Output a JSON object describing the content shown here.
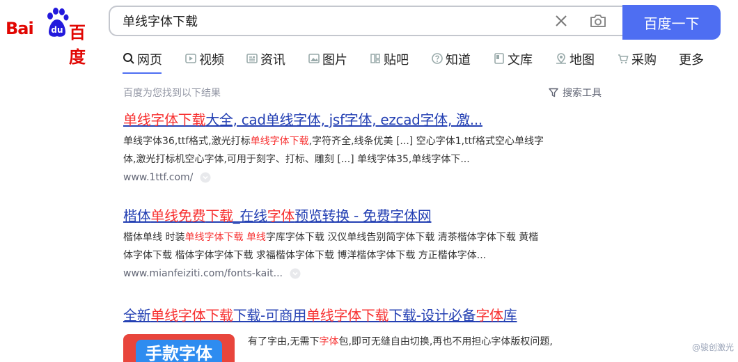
{
  "logo": {
    "text_left": "Bai",
    "text_paw": "du",
    "text_right": "百度"
  },
  "search": {
    "query": "单线字体下载",
    "button_label": "百度一下"
  },
  "tabs": [
    {
      "label": "网页",
      "icon": "search-icon"
    },
    {
      "label": "视频",
      "icon": "video-icon"
    },
    {
      "label": "资讯",
      "icon": "news-icon"
    },
    {
      "label": "图片",
      "icon": "image-icon"
    },
    {
      "label": "贴吧",
      "icon": "tieba-icon"
    },
    {
      "label": "知道",
      "icon": "question-icon"
    },
    {
      "label": "文库",
      "icon": "doc-icon"
    },
    {
      "label": "地图",
      "icon": "map-icon"
    },
    {
      "label": "采购",
      "icon": "cart-icon"
    },
    {
      "label": "更多",
      "icon": ""
    }
  ],
  "meta": {
    "result_count": "百度为您找到以下结果",
    "tools_label": "搜索工具"
  },
  "results": [
    {
      "title_parts": [
        "单线字体下载",
        "大全, cad单线字体, jsf字体, ezcad字体, 激..."
      ],
      "abstract_line1_parts": [
        "单线字体36,ttf格式,激光打标",
        "单线字体下载",
        ",字符齐全,线条优美 [...] 空心字体1,ttf格式空心单线字"
      ],
      "abstract_line2": "体,激光打标机空心字体,可用于刻字、打标、雕刻 [...] 单线字体35,单线字体下...",
      "url": "www.1ttf.com/"
    },
    {
      "title_parts": [
        "楷体",
        "单线",
        "免费",
        "下载",
        "_在线",
        "字体",
        "预览转换 - 免费字体网"
      ],
      "abstract_line1_parts": [
        "楷体单线 时装",
        "单线字体下载",
        " ",
        "单线",
        "字库字体下载 汉仪单线告别简字体下载 清茶楷体字体下载 黄楷"
      ],
      "abstract_line2": "体字体下载 楷体字体字体下载 求福楷体字体下载 博洋楷体字体下载 方正楷体字体...",
      "url": "www.mianfeiziti.com/fonts-kait..."
    },
    {
      "title_parts": [
        "全新",
        "单线字体下载",
        "下载-可商用",
        "单线字体下载",
        "下载-设计必备",
        "字体",
        "库"
      ],
      "abstract_line1_parts": [
        "有了字由,无需下",
        "字体",
        "包,即可无缝自由切换,再也不用担心字体版权问题,"
      ],
      "thumb_text": "手款字体"
    }
  ],
  "watermark": "@骏创激光",
  "colors": {
    "brand_blue": "#4e6ef2",
    "link_blue": "#2440b3",
    "highlight_red": "#f73131",
    "logo_red": "#e10602"
  }
}
